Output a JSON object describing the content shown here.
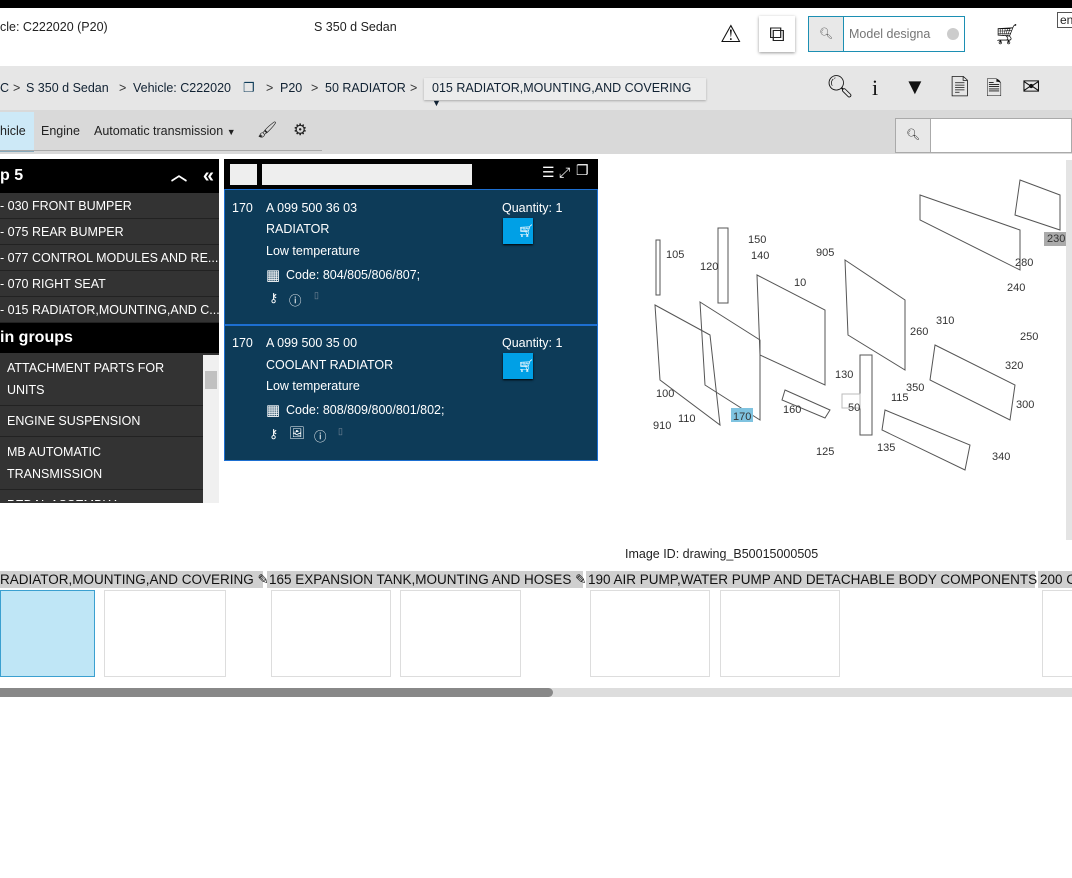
{
  "header": {
    "vehicle": "cle: C222020 (P20)",
    "model": "S 350 d Sedan",
    "search_placeholder": "Model designa",
    "language": "en"
  },
  "breadcrumb": {
    "items": [
      "C",
      "S 350 d Sedan",
      "Vehicle: C222020",
      "P20",
      "50 RADIATOR"
    ],
    "current": "015 RADIATOR,MOUNTING,AND COVERING"
  },
  "tabs": {
    "items": [
      "hicle",
      "Engine",
      "Automatic transmission"
    ]
  },
  "sidebar": {
    "title": "p 5",
    "recent": [
      "- 030 FRONT BUMPER",
      "- 075 REAR BUMPER",
      "- 077 CONTROL MODULES AND RE...",
      "- 070 RIGHT SEAT",
      "- 015 RADIATOR,MOUNTING,AND C..."
    ],
    "groups_title": "in groups",
    "groups": [
      "ATTACHMENT PARTS FOR UNITS",
      "ENGINE SUSPENSION",
      "MB AUTOMATIC TRANSMISSION",
      "PEDAL ASSEMBLY"
    ]
  },
  "parts": [
    {
      "pos": "170",
      "number": "A 099 500 36 03",
      "name": "RADIATOR",
      "note": "Low temperature",
      "code": "Code: 804/805/806/807;",
      "quantity": "Quantity: 1"
    },
    {
      "pos": "170",
      "number": "A 099 500 35 00",
      "name": "COOLANT RADIATOR",
      "note": "Low temperature",
      "code": "Code: 808/809/800/801/802;",
      "quantity": "Quantity: 1"
    }
  ],
  "diagram": {
    "image_id": "Image ID: drawing_B50015000505",
    "callouts": [
      "105",
      "120",
      "150",
      "140",
      "905",
      "10",
      "230",
      "280",
      "240",
      "310",
      "260",
      "250",
      "320",
      "100",
      "130",
      "50",
      "115",
      "350",
      "300",
      "910",
      "110",
      "170",
      "160",
      "125",
      "135",
      "340"
    ],
    "highlight": "170"
  },
  "thumbnails": {
    "groups": [
      "RADIATOR,MOUNTING,AND COVERING",
      "165 EXPANSION TANK,MOUNTING AND HOSES",
      "190 AIR PUMP,WATER PUMP AND DETACHABLE BODY COMPONENTS",
      "200 C"
    ]
  },
  "colors": {
    "card": "#0d3b58",
    "cart": "#00a0e6",
    "accent": "#1d6fd1"
  }
}
